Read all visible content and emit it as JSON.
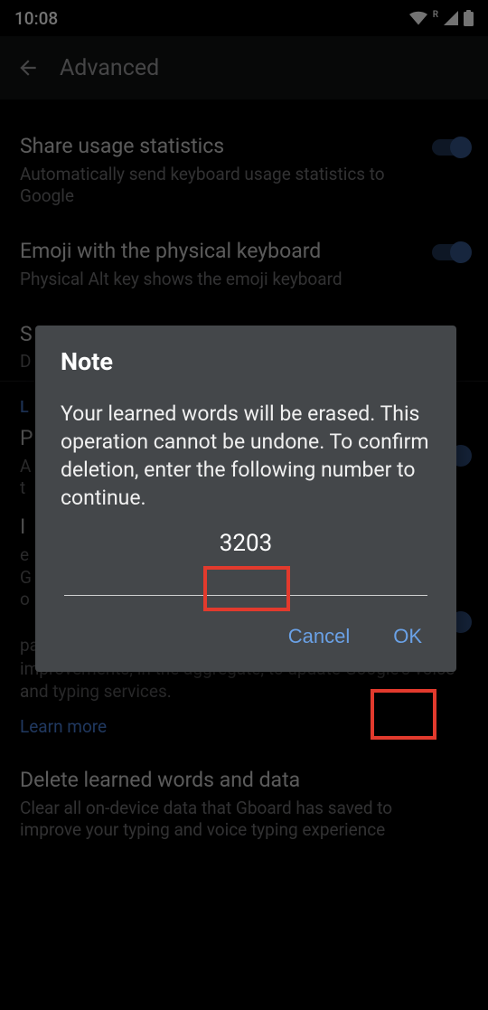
{
  "status": {
    "time": "10:08",
    "signal_label": "R"
  },
  "appbar": {
    "title": "Advanced"
  },
  "settings": {
    "share_stats": {
      "title": "Share usage statistics",
      "sub": "Automatically send keyboard usage statistics to Google"
    },
    "emoji_phys": {
      "title": "Emoji with the physical keyboard",
      "sub": "Physical Alt key shows the emoji keyboard"
    },
    "partial1_title_prefix": "S",
    "partial1_sub_prefix": "D",
    "section_header_prefix": "L",
    "partial2_title_prefix": "P",
    "partial2_sub_line1": "A",
    "partial2_sub_line2": "t",
    "partial3_title_prefix": "I",
    "partial3_sub_line1": "e",
    "partial3_sub_line2": "G",
    "partial3_sub_line3": "o",
    "improve_tail": "patterns. With your permission, Gboard will use these improvements, in the aggregate, to update Google's voice and typing services.",
    "learn_more": "Learn more",
    "delete": {
      "title": "Delete learned words and data",
      "sub": "Clear all on-device data that Gboard has saved to improve your typing and voice typing experience"
    }
  },
  "dialog": {
    "title": "Note",
    "body": "Your learned words will be erased. This operation cannot be undone. To confirm deletion, enter the following number to continue.",
    "number": "3203",
    "cancel": "Cancel",
    "ok": "OK"
  }
}
